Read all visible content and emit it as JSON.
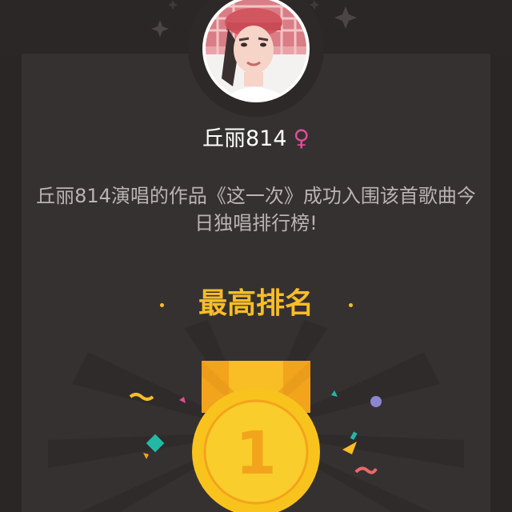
{
  "user": {
    "name": "丘丽814",
    "gender_symbol": "♀"
  },
  "description": "丘丽814演唱的作品《这一次》成功入围该首歌曲今日独唱排行榜!",
  "rank": {
    "title": "最高排名",
    "dot_left": "·",
    "dot_right": "·",
    "position": "1"
  },
  "colors": {
    "background": "#2a2626",
    "card": "#363131",
    "accent_gold": "#f9bd26",
    "medal_orange": "#f2a41d",
    "female_pink": "#e24c98",
    "text_muted": "#b9b4b2"
  },
  "icons": {
    "gender": "female-icon",
    "sparkles": "sparkle-icon",
    "medal": "gold-medal-icon"
  }
}
